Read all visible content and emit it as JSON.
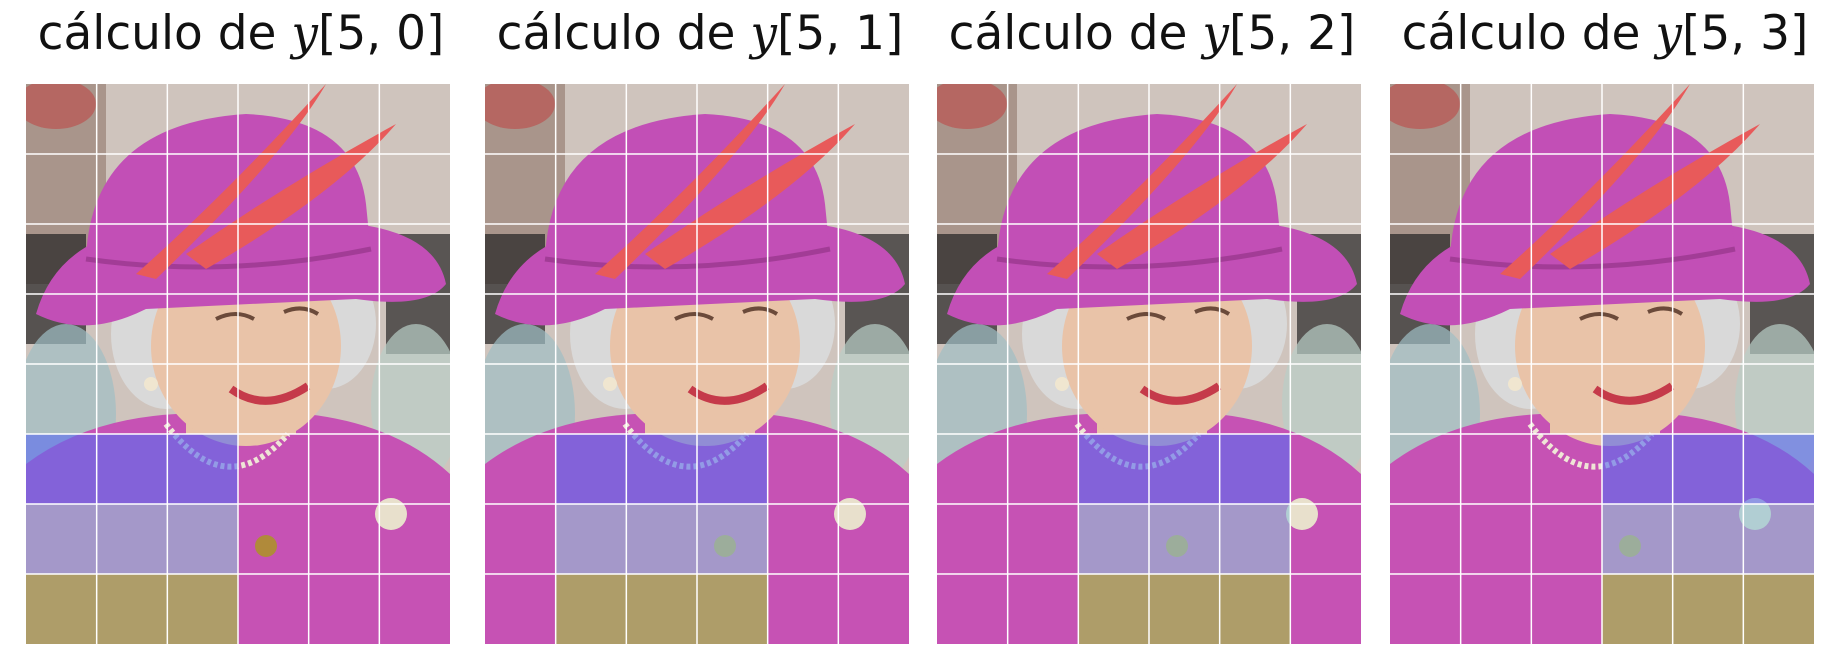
{
  "title_prefix": "cálculo de",
  "panels": [
    {
      "var": "y",
      "index": "[5, 0]",
      "output_col": 0
    },
    {
      "var": "y",
      "index": "[5, 1]",
      "output_col": 1
    },
    {
      "var": "y",
      "index": "[5, 2]",
      "output_col": 2
    },
    {
      "var": "y",
      "index": "[5, 3]",
      "output_col": 3
    }
  ],
  "grid": {
    "rows": 8,
    "cols": 6
  },
  "kernel": {
    "size": 3,
    "output_row": 5,
    "row_colors": [
      "#5a6cf0",
      "#8fc3d6",
      "#9fcc3c"
    ]
  },
  "colors": {
    "grid_lines": "#ffffff",
    "hat": "#c24fb6",
    "feather": "#e85a5a",
    "coat": "#c652b4",
    "skin": "#e9c3a8",
    "hair": "#d9d9d9"
  }
}
